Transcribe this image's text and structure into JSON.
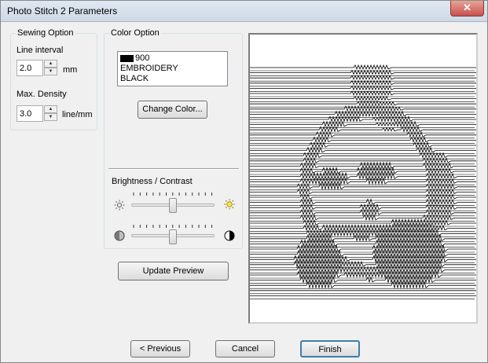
{
  "window": {
    "title": "Photo Stitch 2 Parameters",
    "close_glyph": "✕"
  },
  "sewing_option": {
    "legend": "Sewing Option",
    "line_interval_label": "Line interval",
    "line_interval_value": "2.0",
    "line_interval_unit": "mm",
    "max_density_label": "Max. Density",
    "max_density_value": "3.0",
    "max_density_unit": "line/mm"
  },
  "color_option": {
    "legend": "Color Option",
    "color_lines": [
      "900",
      "EMBROIDERY",
      "BLACK"
    ],
    "swatch_color": "#000000",
    "change_color_label": "Change Color..."
  },
  "brightness_contrast": {
    "label": "Brightness / Contrast",
    "brightness_level": 0.5,
    "contrast_level": 0.5
  },
  "update_preview_label": "Update Preview",
  "footer": {
    "previous_label": "< Previous",
    "cancel_label": "Cancel",
    "finish_label": "Finish"
  },
  "icons": {
    "brightness_low": "sun-outline-icon",
    "brightness_high": "sun-yellow-icon",
    "contrast_low": "contrast-low-icon",
    "contrast_high": "contrast-high-icon"
  }
}
